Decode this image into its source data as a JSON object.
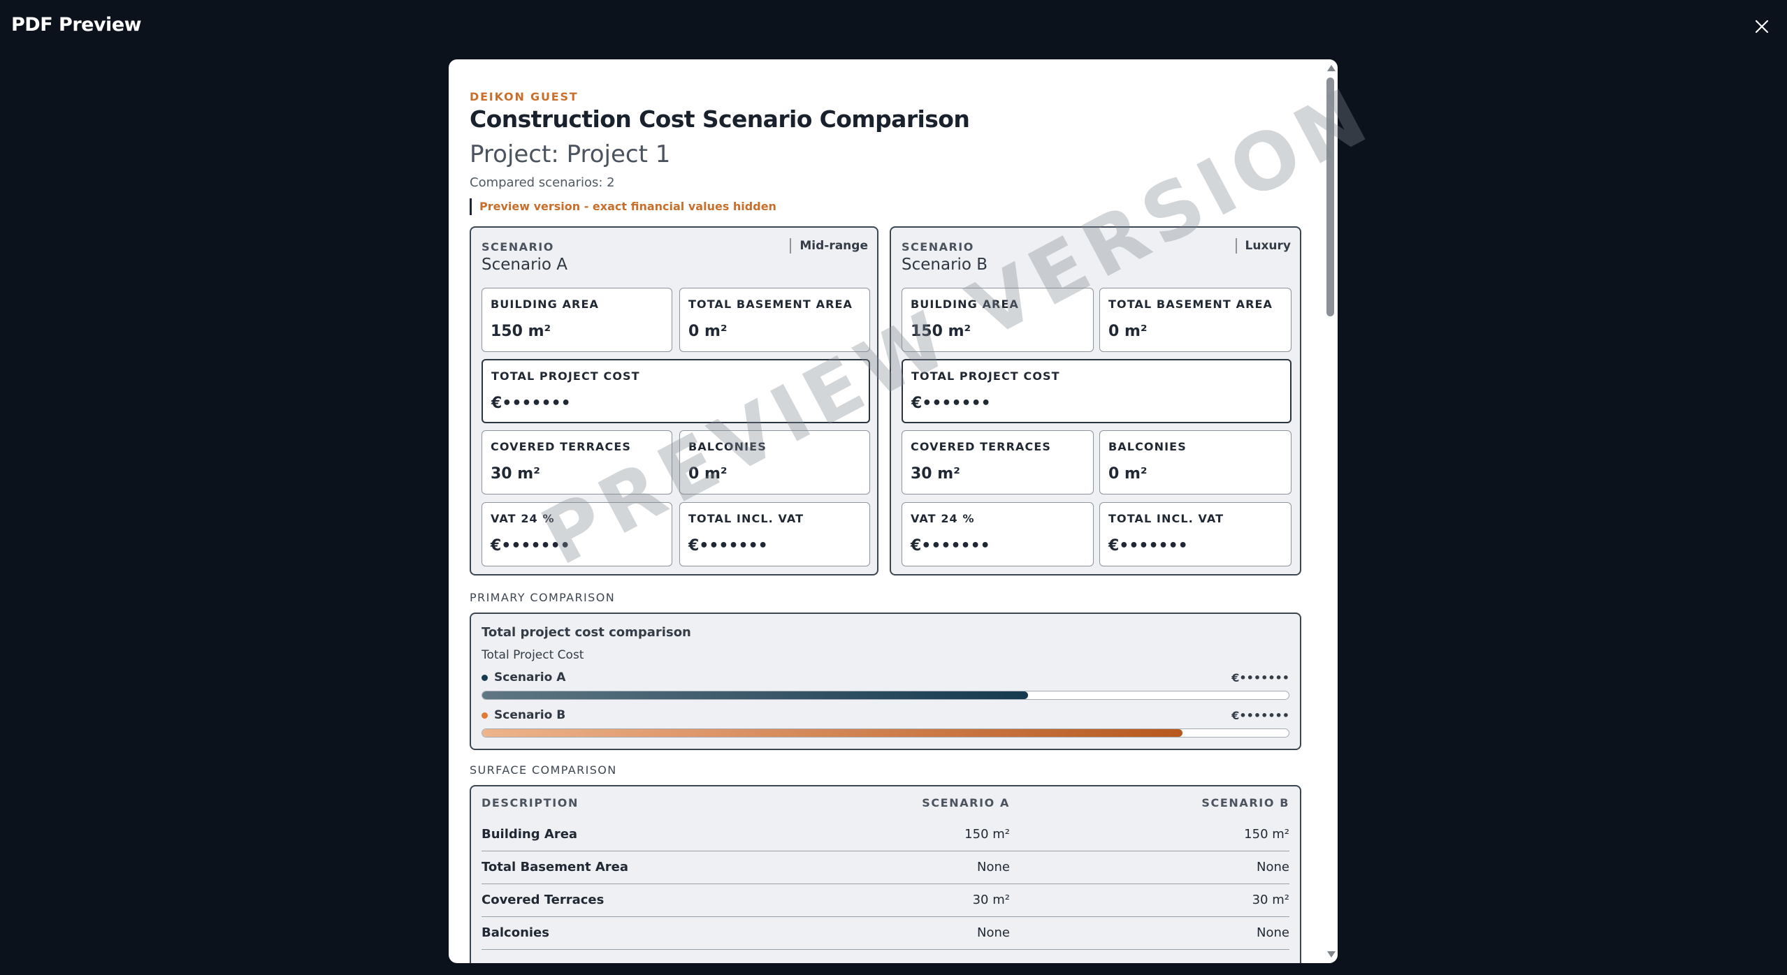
{
  "window": {
    "title": "PDF Preview"
  },
  "watermark": "PREVIEW VERSION",
  "report": {
    "brand": "DEIKON GUEST",
    "title": "Construction Cost Scenario Comparison",
    "project": "Project: Project 1",
    "compared": "Compared scenarios: 2",
    "preview_note": "Preview version - exact financial values hidden"
  },
  "scenarios": [
    {
      "label": "SCENARIO",
      "name": "Scenario A",
      "tier": "Mid-range",
      "building_area": {
        "label": "BUILDING AREA",
        "value": "150 m²"
      },
      "basement_area": {
        "label": "TOTAL BASEMENT AREA",
        "value": "0 m²"
      },
      "project_cost": {
        "label": "TOTAL PROJECT COST",
        "value": "€•••••••"
      },
      "covered_terraces": {
        "label": "COVERED TERRACES",
        "value": "30 m²"
      },
      "balconies": {
        "label": "BALCONIES",
        "value": "0 m²"
      },
      "vat": {
        "label": "VAT 24 %",
        "value": "€•••••••"
      },
      "total_incl_vat": {
        "label": "TOTAL INCL. VAT",
        "value": "€•••••••"
      }
    },
    {
      "label": "SCENARIO",
      "name": "Scenario B",
      "tier": "Luxury",
      "building_area": {
        "label": "BUILDING AREA",
        "value": "150 m²"
      },
      "basement_area": {
        "label": "TOTAL BASEMENT AREA",
        "value": "0 m²"
      },
      "project_cost": {
        "label": "TOTAL PROJECT COST",
        "value": "€•••••••"
      },
      "covered_terraces": {
        "label": "COVERED TERRACES",
        "value": "30 m²"
      },
      "balconies": {
        "label": "BALCONIES",
        "value": "0 m²"
      },
      "vat": {
        "label": "VAT 24 %",
        "value": "€•••••••"
      },
      "total_incl_vat": {
        "label": "TOTAL INCL. VAT",
        "value": "€•••••••"
      }
    }
  ],
  "primary_comparison": {
    "section_title": "PRIMARY COMPARISON",
    "title": "Total project cost comparison",
    "subtitle": "Total Project Cost",
    "bars": [
      {
        "name": "Scenario A",
        "value": "€•••••••",
        "fill_fraction": 0.677,
        "color": "#163a4f"
      },
      {
        "name": "Scenario B",
        "value": "€•••••••",
        "fill_fraction": 0.868,
        "color": "#b7581f"
      }
    ]
  },
  "surface_comparison": {
    "section_title": "SURFACE COMPARISON",
    "headers": [
      "DESCRIPTION",
      "SCENARIO A",
      "SCENARIO B"
    ],
    "rows": [
      [
        "Building Area",
        "150 m²",
        "150 m²"
      ],
      [
        "Total Basement Area",
        "None",
        "None"
      ],
      [
        "Covered Terraces",
        "30 m²",
        "30 m²"
      ],
      [
        "Balconies",
        "None",
        "None"
      ]
    ]
  }
}
